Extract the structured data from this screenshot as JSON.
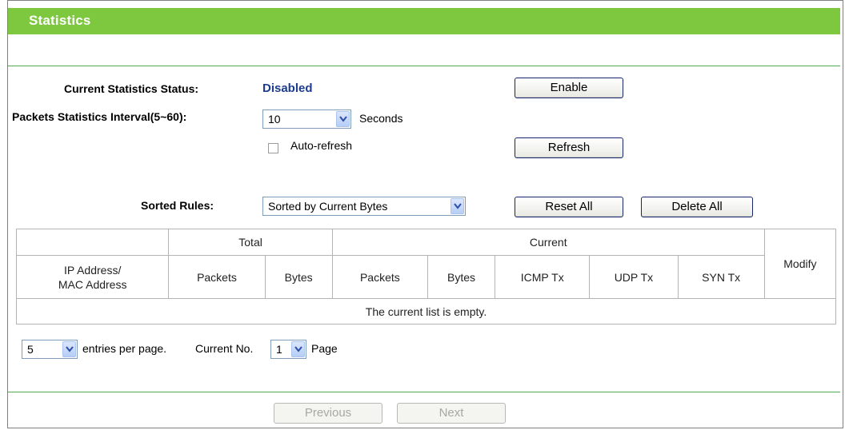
{
  "header": {
    "title": "Statistics"
  },
  "status": {
    "label": "Current Statistics Status:",
    "value": "Disabled",
    "enable_label": "Enable"
  },
  "interval": {
    "label": "Packets Statistics Interval(5~60):",
    "value": "10",
    "unit": "Seconds"
  },
  "autorefresh": {
    "label": "Auto-refresh",
    "checked": false,
    "refresh_label": "Refresh"
  },
  "sort": {
    "label": "Sorted Rules:",
    "value": "Sorted by Current Bytes",
    "reset_label": "Reset All",
    "delete_label": "Delete All"
  },
  "table": {
    "group_total": "Total",
    "group_current": "Current",
    "col_ip": "IP Address/\nMAC Address",
    "columns": [
      "Packets",
      "Bytes",
      "Packets",
      "Bytes",
      "ICMP Tx",
      "UDP Tx",
      "SYN Tx"
    ],
    "col_modify": "Modify",
    "empty_message": "The current list is empty."
  },
  "paging": {
    "per_page_value": "5",
    "per_page_label": "entries per page.",
    "current_label": "Current No.",
    "current_value": "1",
    "page_label": "Page",
    "previous_label": "Previous",
    "next_label": "Next"
  }
}
